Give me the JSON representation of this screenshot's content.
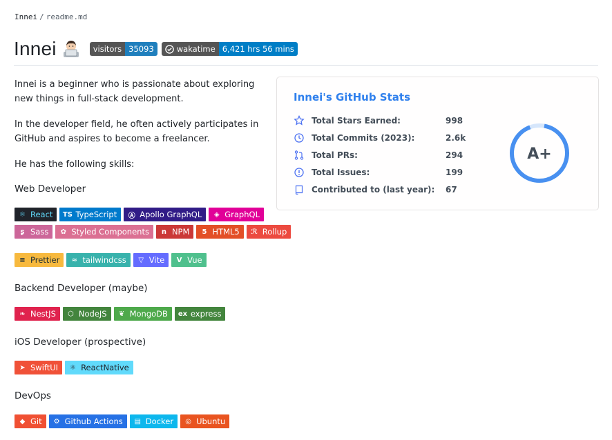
{
  "breadcrumb": {
    "user": "Innei",
    "separator": "/",
    "file": "readme.md"
  },
  "header": {
    "title": "Innei",
    "badges": [
      {
        "label": "visitors",
        "value": "35093"
      },
      {
        "label": "wakatime",
        "value": "6,421 hrs 56 mins"
      }
    ]
  },
  "intro": {
    "p1": "Innei is a beginner who is passionate about exploring new things in full-stack development.",
    "p2": "In the developer field, he often actively participates in GitHub and aspires to become a freelancer.",
    "p3": "He has the following skills:"
  },
  "sections": {
    "web": "Web Developer",
    "backend": "Backend Developer (maybe)",
    "ios": "iOS Developer (prospective)",
    "devops": "DevOps"
  },
  "web_badges_row1": [
    {
      "label": "React",
      "color": "#20232a"
    },
    {
      "label": "TypeScript",
      "color": "#007acc"
    },
    {
      "label": "Apollo GraphQL",
      "color": "#311c87"
    },
    {
      "label": "GraphQL",
      "color": "#e10098"
    }
  ],
  "web_badges_row2": [
    {
      "label": "Sass",
      "color": "#cc6699"
    },
    {
      "label": "Styled Components",
      "color": "#db7093"
    },
    {
      "label": "NPM",
      "color": "#cb3837"
    },
    {
      "label": "HTML5",
      "color": "#e34f26"
    },
    {
      "label": "Rollup",
      "color": "#ec4a3f"
    }
  ],
  "web_badges_row3": [
    {
      "label": "Prettier",
      "color": "#f7b93e"
    },
    {
      "label": "tailwindcss",
      "color": "#38b2ac"
    },
    {
      "label": "Vite",
      "color": "#646cff"
    },
    {
      "label": "Vue",
      "color": "#4fc08d"
    }
  ],
  "backend_badges": [
    {
      "label": "NestJS",
      "color": "#e0234e"
    },
    {
      "label": "NodeJS",
      "color": "#43853d"
    },
    {
      "label": "MongoDB",
      "color": "#4ea94b"
    },
    {
      "label": "express",
      "color": "#43853d"
    }
  ],
  "ios_badges": [
    {
      "label": "SwiftUI",
      "color": "#f05138"
    },
    {
      "label": "ReactNative",
      "color": "#61dafb"
    }
  ],
  "devops_badges": [
    {
      "label": "Git",
      "color": "#f05033"
    },
    {
      "label": "Github Actions",
      "color": "#2671e5"
    },
    {
      "label": "Docker",
      "color": "#0db7ed"
    },
    {
      "label": "Ubuntu",
      "color": "#e95420"
    }
  ],
  "stats": {
    "title": "Innei's GitHub Stats",
    "rows": [
      {
        "icon": "star-icon",
        "label": "Total Stars Earned:",
        "value": "998"
      },
      {
        "icon": "history-icon",
        "label": "Total Commits (2023):",
        "value": "2.6k"
      },
      {
        "icon": "pull-request-icon",
        "label": "Total PRs:",
        "value": "294"
      },
      {
        "icon": "issue-icon",
        "label": "Total Issues:",
        "value": "199"
      },
      {
        "icon": "repo-icon",
        "label": "Contributed to (last year):",
        "value": "67"
      }
    ],
    "grade": "A+",
    "accent": "#2f80ed"
  }
}
